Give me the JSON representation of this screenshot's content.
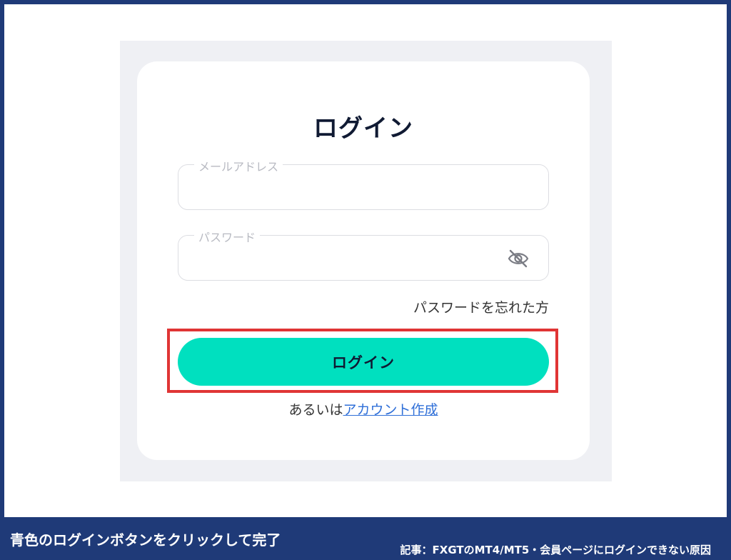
{
  "login": {
    "title": "ログイン",
    "email_label": "メールアドレス",
    "email_value": "",
    "password_label": "パスワード",
    "password_value": "",
    "eye_icon": "eye-slash-icon",
    "forgot_link": "パスワードを忘れた方",
    "login_button": "ログイン",
    "alt_prefix": "あるいは",
    "create_account_link": "アカウント作成"
  },
  "annotation": {
    "caption": "青色のログインボタンをクリックして完了",
    "article": "記事：FXGTのMT4/MT5・会員ページにログインできない原因"
  },
  "colors": {
    "button": "#00e0bf",
    "highlight": "#e03535",
    "frame": "#1f3a78",
    "link": "#2f6fd8"
  }
}
